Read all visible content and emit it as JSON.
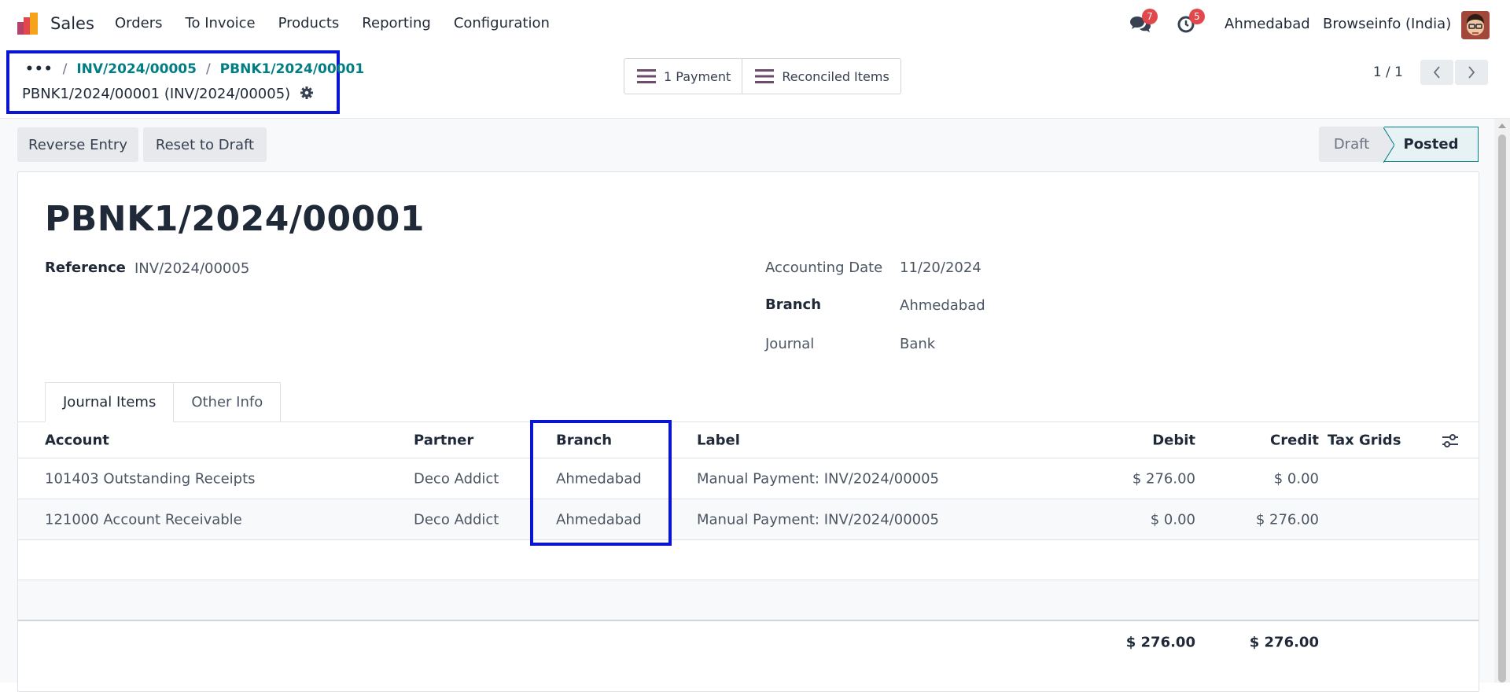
{
  "navbar": {
    "app_name": "Sales",
    "menu": [
      "Orders",
      "To Invoice",
      "Products",
      "Reporting",
      "Configuration"
    ],
    "messages_badge": "7",
    "activities_badge": "5",
    "branch": "Ahmedabad",
    "company": "Browseinfo (India)",
    "icons": [
      "sales-app-logo",
      "chat-icon",
      "clock-icon",
      "user-avatar"
    ]
  },
  "breadcrumb": {
    "dots": "•••",
    "items": [
      "INV/2024/00005",
      "PBNK1/2024/00001"
    ],
    "record_title": "PBNK1/2024/00001 (INV/2024/00005)"
  },
  "smart_buttons": {
    "payment": "1 Payment",
    "reconciled": "Reconciled Items"
  },
  "pager": {
    "value": "1 / 1"
  },
  "actions": {
    "reverse_entry": "Reverse Entry",
    "reset_to_draft": "Reset to Draft"
  },
  "status": {
    "draft": "Draft",
    "posted": "Posted",
    "active": "Posted"
  },
  "form": {
    "title": "PBNK1/2024/00001",
    "reference_label": "Reference",
    "reference_value": "INV/2024/00005",
    "accounting_date_label": "Accounting Date",
    "accounting_date_value": "11/20/2024",
    "branch_label": "Branch",
    "branch_value": "Ahmedabad",
    "journal_label": "Journal",
    "journal_value": "Bank"
  },
  "tabs": [
    "Journal Items",
    "Other Info"
  ],
  "table": {
    "headers": {
      "account": "Account",
      "partner": "Partner",
      "branch": "Branch",
      "label": "Label",
      "debit": "Debit",
      "credit": "Credit",
      "tax_grids": "Tax Grids"
    },
    "rows": [
      {
        "account": "101403 Outstanding Receipts",
        "partner": "Deco Addict",
        "branch": "Ahmedabad",
        "label": "Manual Payment: INV/2024/00005",
        "debit": "$ 276.00",
        "credit": "$ 0.00"
      },
      {
        "account": "121000 Account Receivable",
        "partner": "Deco Addict",
        "branch": "Ahmedabad",
        "label": "Manual Payment: INV/2024/00005",
        "debit": "$ 0.00",
        "credit": "$ 276.00"
      }
    ],
    "totals": {
      "debit": "$ 276.00",
      "credit": "$ 276.00"
    }
  },
  "colors": {
    "accent": "#017e84",
    "highlight": "#0a14d4",
    "badge": "#e2474b",
    "logo_orange": "#f7a21b",
    "logo_red": "#e2474b"
  }
}
